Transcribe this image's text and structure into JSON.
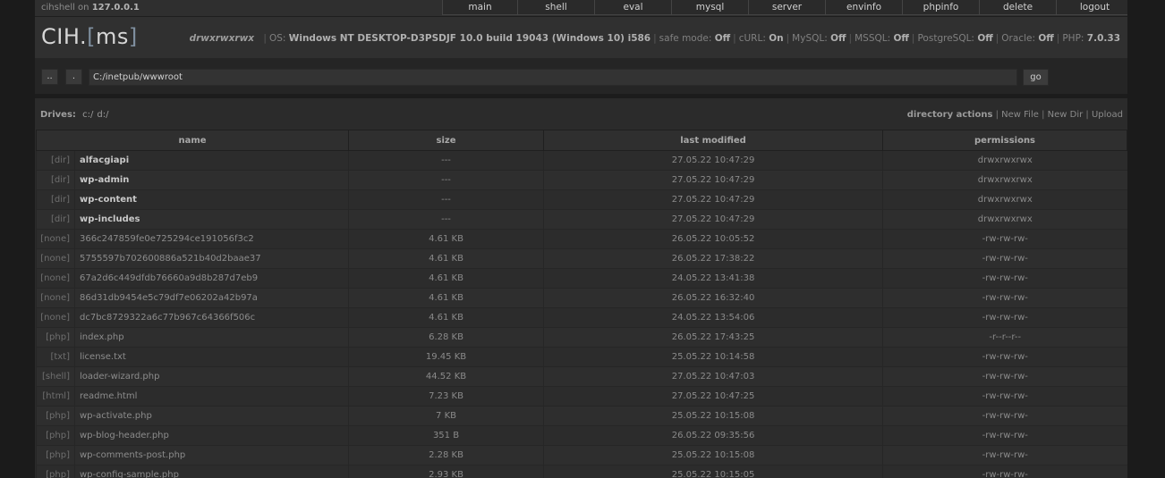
{
  "topbar": {
    "host_prefix": "cihshell on",
    "host_ip": "127.0.0.1",
    "menu": [
      "main",
      "shell",
      "eval",
      "mysql",
      "server",
      "envinfo",
      "phpinfo",
      "delete",
      "logout"
    ]
  },
  "header": {
    "logo_main": "CIH.",
    "logo_bracket_open": "[",
    "logo_inner": "ms",
    "logo_bracket_close": "]",
    "perm": "drwxrwxrwx",
    "sysinfo": [
      {
        "label": "OS:",
        "value": "Windows NT DESKTOP-D3PSDJF 10.0 build 19043 (Windows 10) i586"
      },
      {
        "label": "safe mode:",
        "value": "Off"
      },
      {
        "label": "cURL:",
        "value": "On"
      },
      {
        "label": "MySQL:",
        "value": "Off"
      },
      {
        "label": "MSSQL:",
        "value": "Off"
      },
      {
        "label": "PostgreSQL:",
        "value": "Off"
      },
      {
        "label": "Oracle:",
        "value": "Off"
      },
      {
        "label": "PHP:",
        "value": "7.0.33"
      }
    ]
  },
  "pathbar": {
    "up_label": "..",
    "dot_label": ".",
    "path": "C:/inetpub/wwwroot",
    "go_label": "go"
  },
  "drives": {
    "label": "Drives:",
    "list": [
      "c:/",
      "d:/"
    ],
    "actions_label": "directory actions",
    "actions": [
      "New File",
      "New Dir",
      "Upload"
    ]
  },
  "table": {
    "headers": [
      "name",
      "size",
      "last modified",
      "permissions"
    ],
    "rows": [
      {
        "type": "[dir]",
        "name": "alfacgiapi",
        "size": "---",
        "modified": "27.05.22 10:47:29",
        "perms": "drwxrwxrwx",
        "is_dir": true
      },
      {
        "type": "[dir]",
        "name": "wp-admin",
        "size": "---",
        "modified": "27.05.22 10:47:29",
        "perms": "drwxrwxrwx",
        "is_dir": true
      },
      {
        "type": "[dir]",
        "name": "wp-content",
        "size": "---",
        "modified": "27.05.22 10:47:29",
        "perms": "drwxrwxrwx",
        "is_dir": true
      },
      {
        "type": "[dir]",
        "name": "wp-includes",
        "size": "---",
        "modified": "27.05.22 10:47:29",
        "perms": "drwxrwxrwx",
        "is_dir": true
      },
      {
        "type": "[none]",
        "name": "366c247859fe0e725294ce191056f3c2",
        "size": "4.61 KB",
        "modified": "26.05.22 10:05:52",
        "perms": "-rw-rw-rw-",
        "is_dir": false
      },
      {
        "type": "[none]",
        "name": "5755597b702600886a521b40d2baae37",
        "size": "4.61 KB",
        "modified": "26.05.22 17:38:22",
        "perms": "-rw-rw-rw-",
        "is_dir": false
      },
      {
        "type": "[none]",
        "name": "67a2d6c449dfdb76660a9d8b287d7eb9",
        "size": "4.61 KB",
        "modified": "24.05.22 13:41:38",
        "perms": "-rw-rw-rw-",
        "is_dir": false
      },
      {
        "type": "[none]",
        "name": "86d31db9454e5c79df7e06202a42b97a",
        "size": "4.61 KB",
        "modified": "26.05.22 16:32:40",
        "perms": "-rw-rw-rw-",
        "is_dir": false
      },
      {
        "type": "[none]",
        "name": "dc7bc8729322a6c77b967c64366f506c",
        "size": "4.61 KB",
        "modified": "24.05.22 13:54:06",
        "perms": "-rw-rw-rw-",
        "is_dir": false
      },
      {
        "type": "[php]",
        "name": "index.php",
        "size": "6.28 KB",
        "modified": "26.05.22 17:43:25",
        "perms": "-r--r--r--",
        "is_dir": false
      },
      {
        "type": "[txt]",
        "name": "license.txt",
        "size": "19.45 KB",
        "modified": "25.05.22 10:14:58",
        "perms": "-rw-rw-rw-",
        "is_dir": false
      },
      {
        "type": "[shell]",
        "name": "loader-wizard.php",
        "size": "44.52 KB",
        "modified": "27.05.22 10:47:03",
        "perms": "-rw-rw-rw-",
        "is_dir": false
      },
      {
        "type": "[html]",
        "name": "readme.html",
        "size": "7.23 KB",
        "modified": "27.05.22 10:47:25",
        "perms": "-rw-rw-rw-",
        "is_dir": false
      },
      {
        "type": "[php]",
        "name": "wp-activate.php",
        "size": "7 KB",
        "modified": "25.05.22 10:15:08",
        "perms": "-rw-rw-rw-",
        "is_dir": false
      },
      {
        "type": "[php]",
        "name": "wp-blog-header.php",
        "size": "351 B",
        "modified": "26.05.22 09:35:56",
        "perms": "-rw-rw-rw-",
        "is_dir": false
      },
      {
        "type": "[php]",
        "name": "wp-comments-post.php",
        "size": "2.28 KB",
        "modified": "25.05.22 10:15:08",
        "perms": "-rw-rw-rw-",
        "is_dir": false
      },
      {
        "type": "[php]",
        "name": "wp-config-sample.php",
        "size": "2.93 KB",
        "modified": "25.05.22 10:15:05",
        "perms": "-rw-rw-rw-",
        "is_dir": false
      }
    ]
  }
}
